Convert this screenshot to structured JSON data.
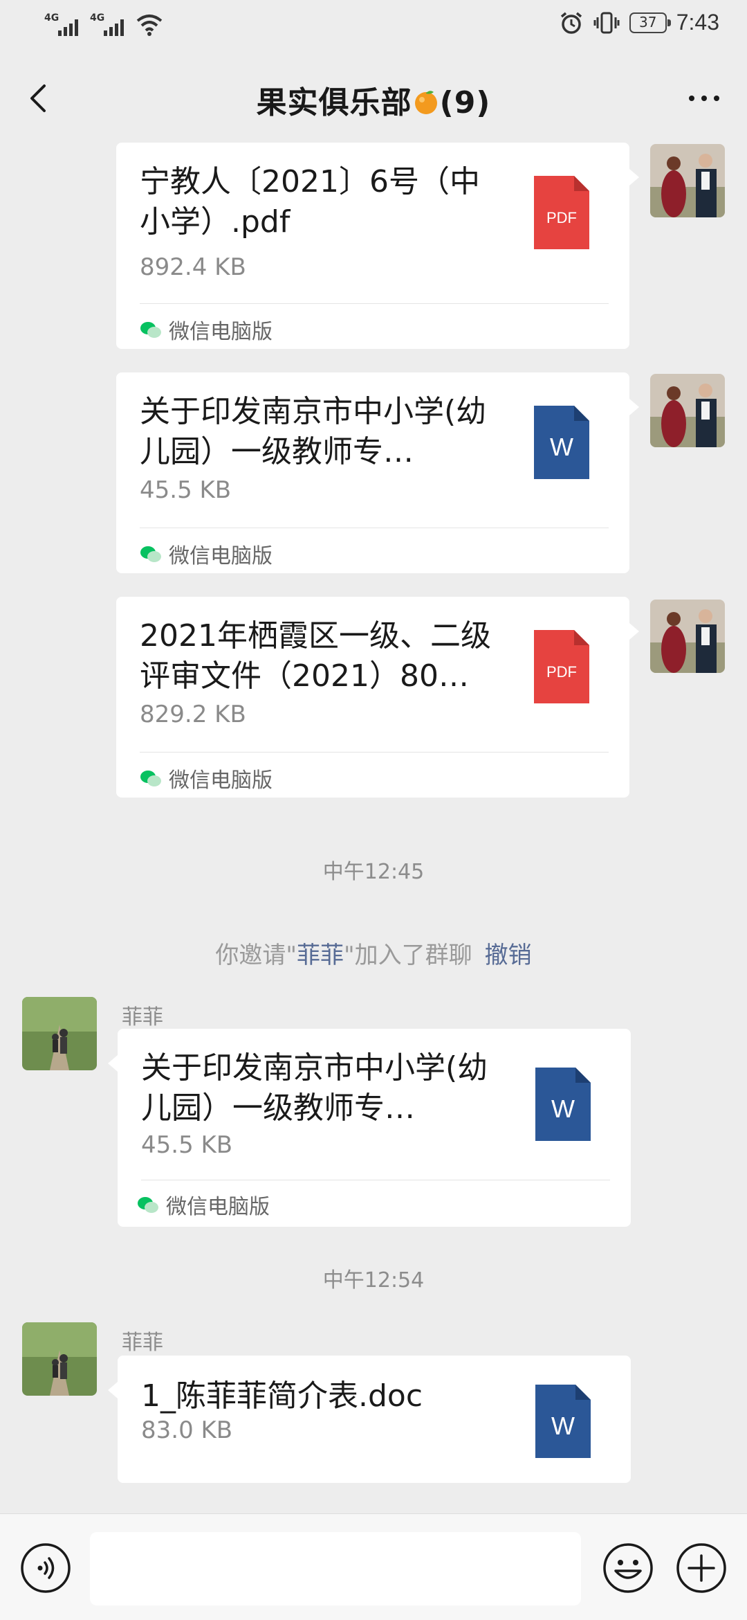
{
  "status_bar": {
    "signal_1_label": "4G",
    "signal_2_label": "4G",
    "battery": "37",
    "time": "7:43"
  },
  "header": {
    "title": "果实俱乐部",
    "count": "(9)"
  },
  "messages": [
    {
      "file_name": "宁教人〔2021〕6号（中小学）.pdf",
      "file_size": "892.4 KB",
      "source": "微信电脑版",
      "file_type": "pdf",
      "icon_label": "PDF"
    },
    {
      "file_name": "关于印发南京市中小学(幼儿园）一级教师专…",
      "file_size": "45.5 KB",
      "source": "微信电脑版",
      "file_type": "word",
      "icon_label": "W"
    },
    {
      "file_name": "2021年栖霞区一级、二级评审文件（2021）80…",
      "file_size": "829.2 KB",
      "source": "微信电脑版",
      "file_type": "pdf",
      "icon_label": "PDF"
    },
    {
      "sender": "菲菲",
      "file_name": "关于印发南京市中小学(幼儿园）一级教师专…",
      "file_size": "45.5 KB",
      "source": "微信电脑版",
      "file_type": "word",
      "icon_label": "W"
    },
    {
      "sender": "菲菲",
      "file_name": "1_陈菲菲简介表.doc",
      "file_size": "83.0 KB",
      "file_type": "word",
      "icon_label": "W"
    }
  ],
  "timestamps": [
    "中午12:45",
    "中午12:54"
  ],
  "system_notice": {
    "prefix": "你邀请\"",
    "name": "菲菲",
    "suffix": "\"加入了群聊",
    "revoke": "撤销"
  },
  "colors": {
    "background": "#ededed",
    "pdf_red": "#e64340",
    "word_blue": "#2b5797",
    "link_blue": "#576b95"
  },
  "icons": {
    "back": "back-arrow-icon",
    "more": "more-dots-icon",
    "voice": "voice-icon",
    "emoji": "emoji-icon",
    "plus": "plus-icon"
  }
}
